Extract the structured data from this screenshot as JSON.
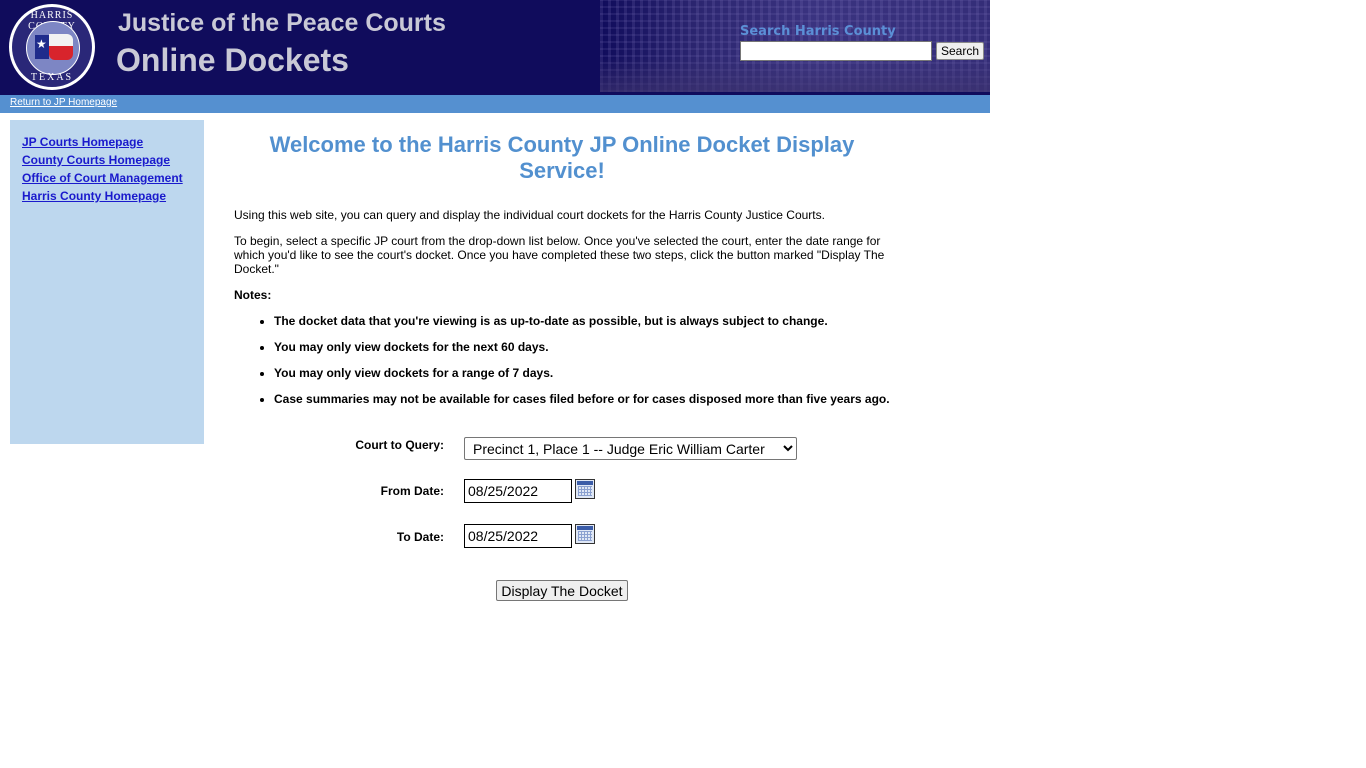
{
  "header": {
    "seal": {
      "top_text": "HARRIS COUNTY",
      "bottom_text": "TEXAS"
    },
    "title_line1": "Justice of the Peace Courts",
    "title_line2": "Online Dockets",
    "search": {
      "label": "Search Harris County",
      "value": "",
      "button_label": "Search"
    }
  },
  "navbar": {
    "return_link": "Return to JP Homepage"
  },
  "sidebar": {
    "items": [
      {
        "label": "JP Courts Homepage"
      },
      {
        "label": "County Courts Homepage"
      },
      {
        "label": "Office of Court Management"
      },
      {
        "label": "Harris County Homepage"
      }
    ]
  },
  "main": {
    "heading": "Welcome to the Harris County JP Online Docket Display Service!",
    "intro1": "Using this web site, you can query and display the individual court dockets for the Harris County Justice Courts.",
    "intro2": "To begin, select a specific JP court from the drop-down list below. Once you've selected the court, enter the date range for which you'd like to see the court's docket. Once you have completed these two steps, click the button marked \"Display The Docket.\"",
    "notes_label": "Notes:",
    "notes": [
      "The docket data that you're viewing is as up-to-date as possible, but is always subject to change.",
      "You may only view dockets for the next 60 days.",
      "You may only view dockets for a range of 7 days.",
      "Case summaries may not be available for cases filed before or for cases disposed more than five years ago."
    ]
  },
  "form": {
    "court_label": "Court to Query:",
    "court_selected": "Precinct 1, Place 1 -- Judge Eric William Carter",
    "from_label": "From Date:",
    "from_value": "08/25/2022",
    "to_label": "To Date:",
    "to_value": "08/25/2022",
    "submit_label": "Display The Docket"
  }
}
